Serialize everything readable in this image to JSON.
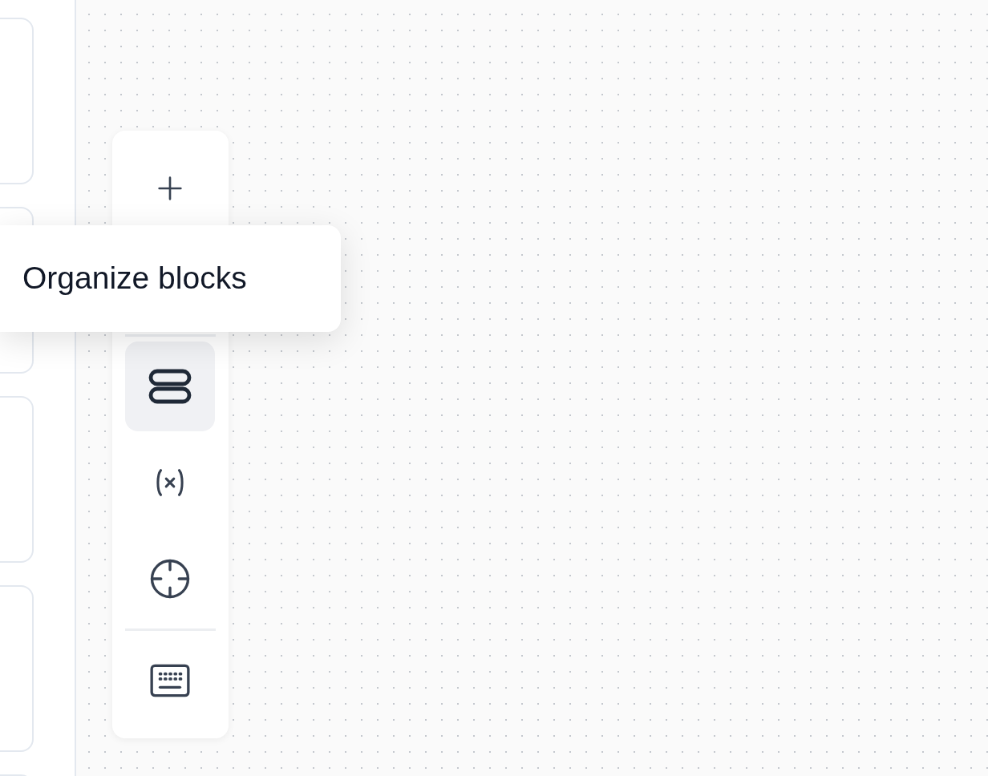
{
  "toolbar": {
    "groups": [
      [
        {
          "kind": "add",
          "selected": false
        },
        {
          "kind": "hidden"
        }
      ],
      [
        {
          "kind": "organize",
          "selected": true
        },
        {
          "kind": "variables",
          "selected": false
        },
        {
          "kind": "target",
          "selected": false
        }
      ],
      [
        {
          "kind": "keyboard",
          "selected": false
        }
      ]
    ]
  },
  "tooltip": {
    "text": "Organize blocks"
  }
}
